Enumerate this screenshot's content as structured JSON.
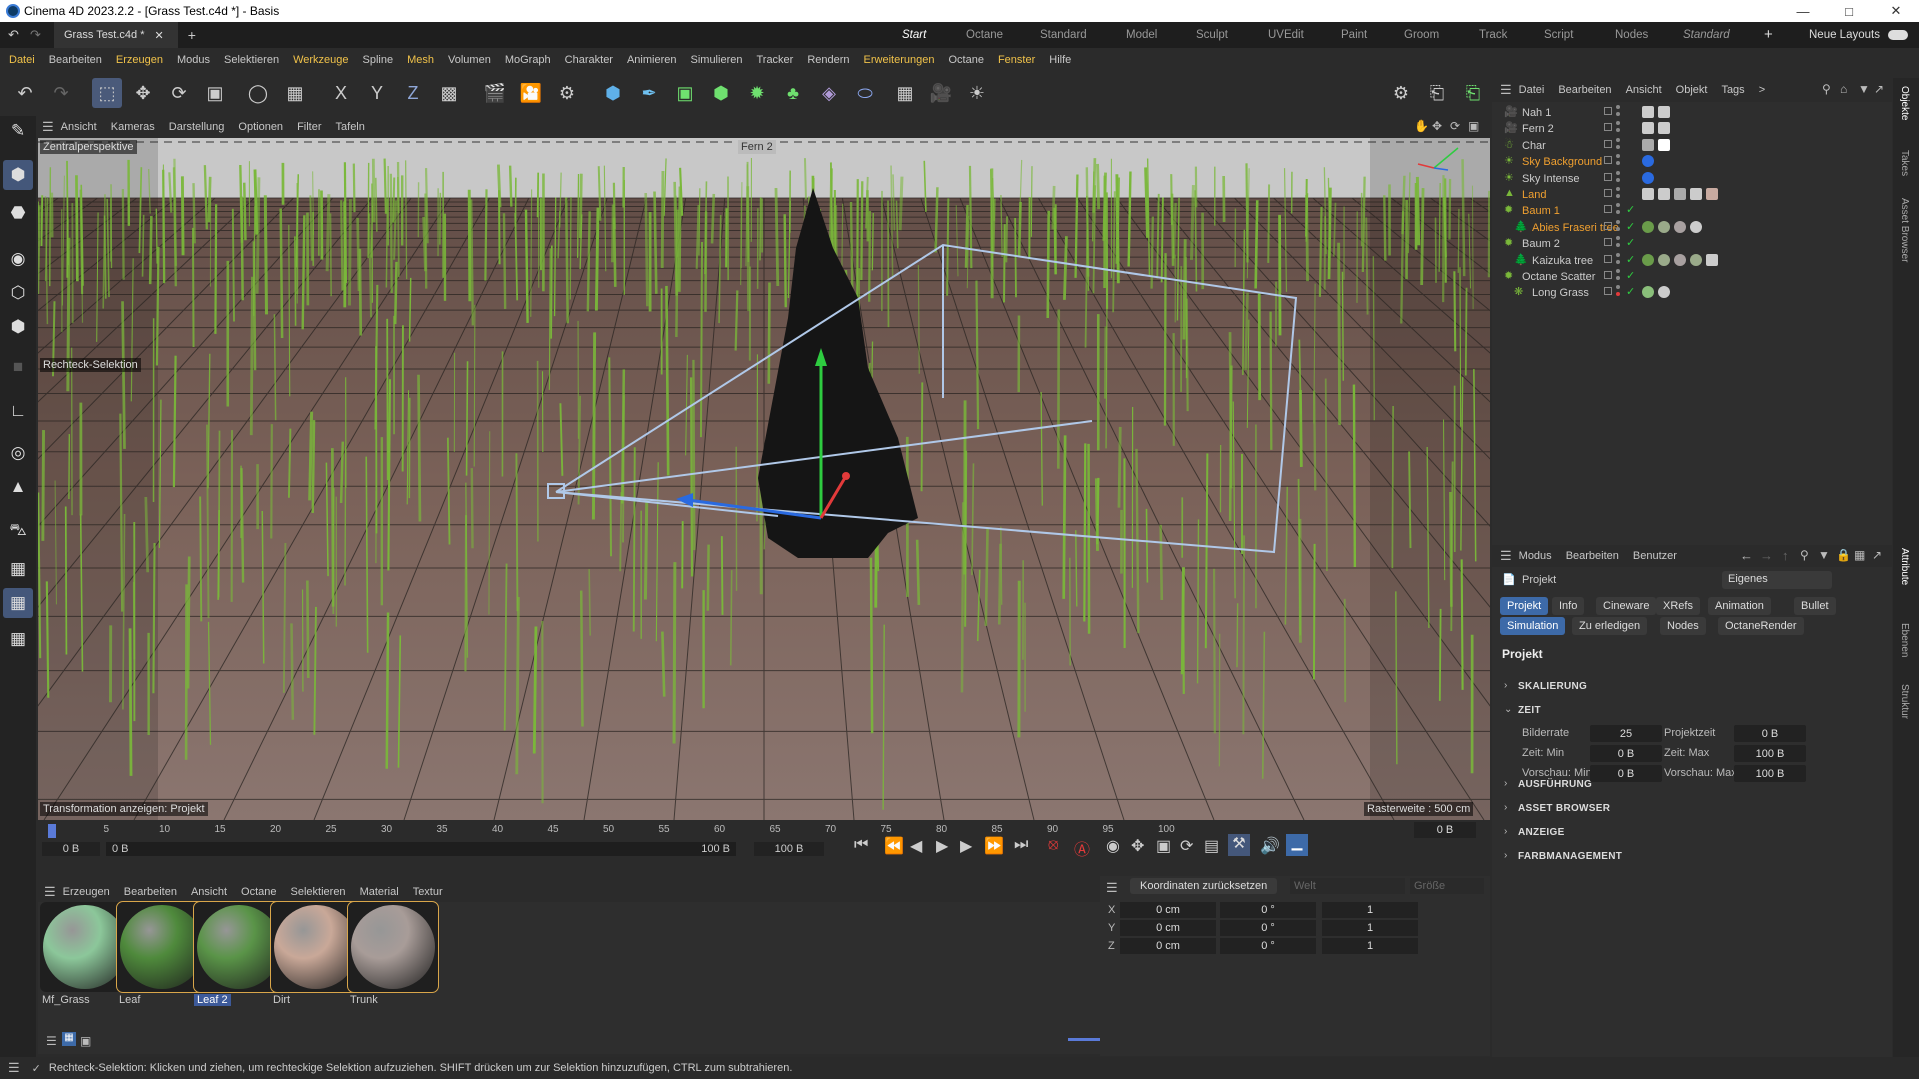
{
  "window": {
    "title": "Cinema 4D 2023.2.2 - [Grass Test.c4d *] - Basis"
  },
  "tabs": {
    "file": "Grass Test.c4d *",
    "layouts": [
      "Start",
      "Octane",
      "Standard",
      "Model",
      "Sculpt",
      "UVEdit",
      "Paint",
      "Groom",
      "Track",
      "Script",
      "Nodes",
      "Standard"
    ],
    "neue_layouts": "Neue Layouts"
  },
  "menu": [
    "Datei",
    "Bearbeiten",
    "Erzeugen",
    "Modus",
    "Selektieren",
    "Werkzeuge",
    "Spline",
    "Mesh",
    "Volumen",
    "MoGraph",
    "Charakter",
    "Animieren",
    "Simulieren",
    "Tracker",
    "Rendern",
    "Erweiterungen",
    "Octane",
    "Fenster",
    "Hilfe"
  ],
  "viewport": {
    "menu": [
      "Ansicht",
      "Kameras",
      "Darstellung",
      "Optionen",
      "Filter",
      "Tafeln"
    ],
    "perspective": "Zentralperspektive",
    "camera": "Fern 2",
    "selection_tool": "Rechteck-Selektion",
    "transform_info": "Transformation anzeigen: Projekt",
    "grid_width": "Rasterweite : 500 cm"
  },
  "timeline": {
    "ticks": [
      "0",
      "5",
      "10",
      "15",
      "20",
      "25",
      "30",
      "35",
      "40",
      "45",
      "50",
      "55",
      "60",
      "65",
      "70",
      "75",
      "80",
      "85",
      "90",
      "95",
      "100"
    ],
    "current": "0 B",
    "start": "0 B",
    "start2": "0 B",
    "end": "100 B",
    "end2": "100 B"
  },
  "materials": {
    "menu": [
      "Erzeugen",
      "Bearbeiten",
      "Ansicht",
      "Octane",
      "Selektieren",
      "Material",
      "Textur"
    ],
    "items": [
      {
        "name": "Mf_Grass",
        "color": "#8cc79a"
      },
      {
        "name": "Leaf",
        "color": "#4f8a3c"
      },
      {
        "name": "Leaf 2",
        "color": "#5a9448"
      },
      {
        "name": "Dirt",
        "color": "#c9a898"
      },
      {
        "name": "Trunk",
        "color": "#a89c98"
      }
    ]
  },
  "coords": {
    "reset": "Koordinaten zurücksetzen",
    "mode1": "Welt",
    "mode2": "Größe",
    "rows": [
      {
        "axis": "X",
        "pos": "0 cm",
        "rot": "0 °",
        "scale": "1"
      },
      {
        "axis": "Y",
        "pos": "0 cm",
        "rot": "0 °",
        "scale": "1"
      },
      {
        "axis": "Z",
        "pos": "0 cm",
        "rot": "0 °",
        "scale": "1"
      }
    ]
  },
  "objects": {
    "menu": [
      "Datei",
      "Bearbeiten",
      "Ansicht",
      "Objekt",
      "Tags"
    ],
    "items": [
      {
        "name": "Nah 1",
        "icon": "camera-icon",
        "color": "#cccccc",
        "indent": 0
      },
      {
        "name": "Fern 2",
        "icon": "camera-icon",
        "color": "#cccccc",
        "indent": 0
      },
      {
        "name": "Char",
        "icon": "figure-icon",
        "color": "#cccccc",
        "indent": 0
      },
      {
        "name": "Sky Background",
        "icon": "sky-icon",
        "color": "#f0a030",
        "indent": 0
      },
      {
        "name": "Sky Intense",
        "icon": "sky-icon",
        "color": "#cccccc",
        "indent": 0
      },
      {
        "name": "Land",
        "icon": "landscape-icon",
        "color": "#f0a030",
        "indent": 0
      },
      {
        "name": "Baum 1",
        "icon": "scatter-icon",
        "color": "#f0a030",
        "indent": 0
      },
      {
        "name": "Abies Fraseri tree",
        "icon": "tree-icon",
        "color": "#f0a030",
        "indent": 1
      },
      {
        "name": "Baum 2",
        "icon": "scatter-icon",
        "color": "#cccccc",
        "indent": 0
      },
      {
        "name": "Kaizuka tree",
        "icon": "tree-icon",
        "color": "#cccccc",
        "indent": 1
      },
      {
        "name": "Octane Scatter",
        "icon": "scatter-icon",
        "color": "#cccccc",
        "indent": 0
      },
      {
        "name": "Long Grass",
        "icon": "grass-icon",
        "color": "#cccccc",
        "indent": 1
      }
    ]
  },
  "attributes": {
    "menu": [
      "Modus",
      "Bearbeiten",
      "Benutzer"
    ],
    "project": "Projekt",
    "preset": "Eigenes",
    "tabs1": [
      "Projekt",
      "Info",
      "Cineware",
      "XRefs",
      "Animation",
      "Bullet"
    ],
    "tabs2": [
      "Simulation",
      "Zu erledigen",
      "Nodes",
      "OctaneRender"
    ],
    "heading": "Projekt",
    "sections": [
      "SKALIERUNG",
      "ZEIT",
      "AUSFÜHRUNG",
      "ASSET BROWSER",
      "ANZEIGE",
      "FARBMANAGEMENT"
    ],
    "fields": [
      {
        "label": "Bilderrate",
        "value": "25"
      },
      {
        "label": "Projektzeit",
        "value": "0 B"
      },
      {
        "label": "Zeit: Min",
        "value": "0 B"
      },
      {
        "label": "Zeit: Max",
        "value": "100 B"
      },
      {
        "label": "Vorschau: Min",
        "value": "0 B"
      },
      {
        "label": "Vorschau: Max",
        "value": "100 B"
      }
    ]
  },
  "side_tabs": [
    "Objekte",
    "Takes",
    "Asset Browser",
    "Attribute",
    "Ebenen",
    "Struktur"
  ],
  "status": "Rechteck-Selektion: Klicken und ziehen, um rechteckige Selektion aufzuziehen. SHIFT drücken um zur Selektion hinzuzufügen, CTRL zum subtrahieren."
}
